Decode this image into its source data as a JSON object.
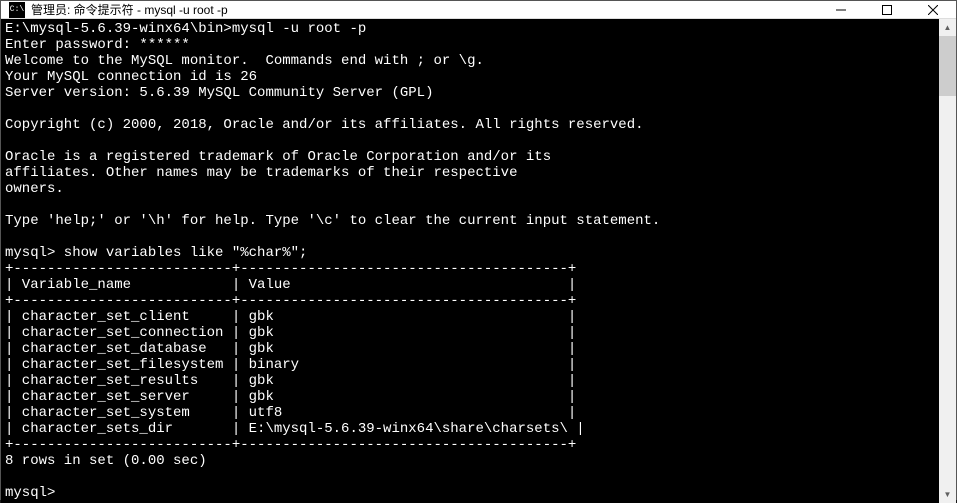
{
  "window": {
    "icon_text": "C:\\",
    "title": "管理员: 命令提示符 - mysql  -u root -p"
  },
  "session": {
    "prompt_path": "E:\\mysql-5.6.39-winx64\\bin>",
    "launch_cmd": "mysql -u root -p",
    "password_label": "Enter password: ",
    "password_mask": "******",
    "welcome_line": "Welcome to the MySQL monitor.  Commands end with ; or \\g.",
    "connection_id_line": "Your MySQL connection id is 26",
    "server_version_line": "Server version: 5.6.39 MySQL Community Server (GPL)",
    "copyright_line": "Copyright (c) 2000, 2018, Oracle and/or its affiliates. All rights reserved.",
    "trademark_lines": [
      "Oracle is a registered trademark of Oracle Corporation and/or its",
      "affiliates. Other names may be trademarks of their respective",
      "owners."
    ],
    "help_line": "Type 'help;' or '\\h' for help. Type '\\c' to clear the current input statement.",
    "mysql_prompt": "mysql>",
    "query": "show variables like \"%char%\";"
  },
  "table": {
    "border_top": "+--------------------------+---------------------------------------+",
    "header_row": "| Variable_name            | Value                                 |",
    "columns": [
      "Variable_name",
      "Value"
    ],
    "rows": [
      {
        "name": "character_set_client",
        "value": "gbk"
      },
      {
        "name": "character_set_connection",
        "value": "gbk"
      },
      {
        "name": "character_set_database",
        "value": "gbk"
      },
      {
        "name": "character_set_filesystem",
        "value": "binary"
      },
      {
        "name": "character_set_results",
        "value": "gbk"
      },
      {
        "name": "character_set_server",
        "value": "gbk"
      },
      {
        "name": "character_set_system",
        "value": "utf8"
      },
      {
        "name": "character_sets_dir",
        "value": "E:\\mysql-5.6.39-winx64\\share\\charsets\\"
      }
    ],
    "summary": "8 rows in set (0.00 sec)"
  }
}
